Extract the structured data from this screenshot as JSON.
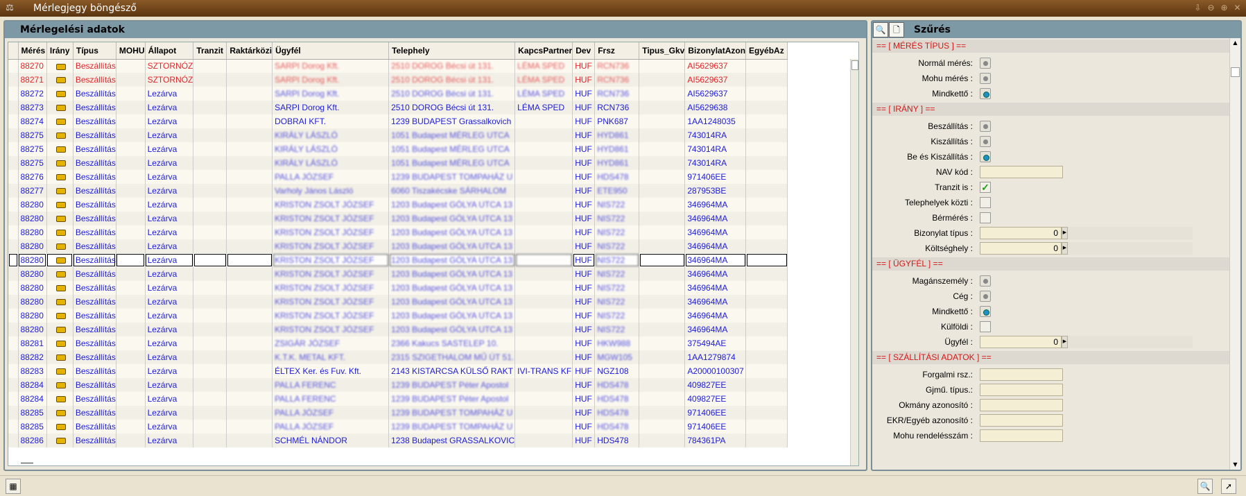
{
  "window": {
    "title": "Mérlegjegy böngésző"
  },
  "left": {
    "title": "Mérlegelési adatok",
    "columns": [
      "",
      "Mérés",
      "Irány",
      "Típus",
      "MOHU",
      "Állapot",
      "Tranzit",
      "Raktárközi",
      "Ügyfél",
      "Telephely",
      "KapcsPartner",
      "Dev",
      "Frsz",
      "Tipus_Gkv",
      "BizonylatAzon",
      "EgyébAz"
    ]
  },
  "rows": [
    {
      "id": "88270",
      "tipus": "Beszállítás",
      "allapot": "SZTORNÓZ",
      "ugyfel": "SARPI Dorog Kft.",
      "telephely": "2510 DOROG Bécsi út 131.",
      "kapcs": "LÉMA SPED",
      "dev": "HUF",
      "frsz": "RCN736",
      "biz": "AI5629637",
      "color": "red"
    },
    {
      "id": "88271",
      "tipus": "Beszállítás",
      "allapot": "SZTORNÓZ",
      "ugyfel": "SARPI Dorog Kft.",
      "telephely": "2510 DOROG Bécsi út 131.",
      "kapcs": "LÉMA SPED",
      "dev": "HUF",
      "frsz": "RCN736",
      "biz": "AI5629637",
      "color": "red"
    },
    {
      "id": "88272",
      "tipus": "Beszállítás",
      "allapot": "Lezárva",
      "ugyfel": "SARPI Dorog Kft.",
      "telephely": "2510 DOROG Bécsi út 131.",
      "kapcs": "LÉMA SPED",
      "dev": "HUF",
      "frsz": "RCN736",
      "biz": "AI5629637",
      "color": "blue"
    },
    {
      "id": "88273",
      "tipus": "Beszállítás",
      "allapot": "Lezárva",
      "ugyfel": "SARPI Dorog Kft.",
      "telephely": "2510 DOROG Bécsi út 131.",
      "kapcs": "LÉMA SPED",
      "dev": "HUF",
      "frsz": "RCN736",
      "biz": "AI5629638",
      "color": "blue"
    },
    {
      "id": "88274",
      "tipus": "Beszállítás",
      "allapot": "Lezárva",
      "ugyfel": "DOBRAI KFT.",
      "telephely": "1239 BUDAPEST Grassalkovich",
      "kapcs": "",
      "dev": "HUF",
      "frsz": "PNK687",
      "biz": "1AA1248035",
      "color": "blue"
    },
    {
      "id": "88275",
      "tipus": "Beszállítás",
      "allapot": "Lezárva",
      "ugyfel": "KIRÁLY LÁSZLÓ",
      "telephely": "1051 Budapest MÉRLEG UTCA",
      "kapcs": "",
      "dev": "HUF",
      "frsz": "HYD861",
      "biz": "743014RA",
      "color": "blue"
    },
    {
      "id": "88275",
      "tipus": "Beszállítás",
      "allapot": "Lezárva",
      "ugyfel": "KIRÁLY LÁSZLÓ",
      "telephely": "1051 Budapest MÉRLEG UTCA",
      "kapcs": "",
      "dev": "HUF",
      "frsz": "HYD861",
      "biz": "743014RA",
      "color": "blue"
    },
    {
      "id": "88275",
      "tipus": "Beszállítás",
      "allapot": "Lezárva",
      "ugyfel": "KIRÁLY LÁSZLÓ",
      "telephely": "1051 Budapest MÉRLEG UTCA",
      "kapcs": "",
      "dev": "HUF",
      "frsz": "HYD861",
      "biz": "743014RA",
      "color": "blue"
    },
    {
      "id": "88276",
      "tipus": "Beszállítás",
      "allapot": "Lezárva",
      "ugyfel": "PALLA JÓZSEF",
      "telephely": "1239 BUDAPEST TOMPAHÁZ U",
      "kapcs": "",
      "dev": "HUF",
      "frsz": "HDS478",
      "biz": "971406EE",
      "color": "blue"
    },
    {
      "id": "88277",
      "tipus": "Beszállítás",
      "allapot": "Lezárva",
      "ugyfel": "Varholy János László",
      "telephely": "6060 Tiszakécske SÁRHALOM",
      "kapcs": "",
      "dev": "HUF",
      "frsz": "ETE950",
      "biz": "287953BE",
      "color": "blue"
    },
    {
      "id": "88280",
      "tipus": "Beszállítás",
      "allapot": "Lezárva",
      "ugyfel": "KRISTON ZSOLT JÓZSEF",
      "telephely": "1203 Budapest GÓLYA UTCA 13",
      "kapcs": "",
      "dev": "HUF",
      "frsz": "NIS722",
      "biz": "346964MA",
      "color": "blue"
    },
    {
      "id": "88280",
      "tipus": "Beszállítás",
      "allapot": "Lezárva",
      "ugyfel": "KRISTON ZSOLT JÓZSEF",
      "telephely": "1203 Budapest GÓLYA UTCA 13",
      "kapcs": "",
      "dev": "HUF",
      "frsz": "NIS722",
      "biz": "346964MA",
      "color": "blue"
    },
    {
      "id": "88280",
      "tipus": "Beszállítás",
      "allapot": "Lezárva",
      "ugyfel": "KRISTON ZSOLT JÓZSEF",
      "telephely": "1203 Budapest GÓLYA UTCA 13",
      "kapcs": "",
      "dev": "HUF",
      "frsz": "NIS722",
      "biz": "346964MA",
      "color": "blue"
    },
    {
      "id": "88280",
      "tipus": "Beszállítás",
      "allapot": "Lezárva",
      "ugyfel": "KRISTON ZSOLT JÓZSEF",
      "telephely": "1203 Budapest GÓLYA UTCA 13",
      "kapcs": "",
      "dev": "HUF",
      "frsz": "NIS722",
      "biz": "346964MA",
      "color": "blue"
    },
    {
      "id": "88280",
      "tipus": "Beszállítás",
      "allapot": "Lezárva",
      "ugyfel": "KRISTON ZSOLT JÓZSEF",
      "telephely": "1203 Budapest GÓLYA UTCA 13",
      "kapcs": "",
      "dev": "HUF",
      "frsz": "NIS722",
      "biz": "346964MA",
      "color": "blue",
      "selected": true
    },
    {
      "id": "88280",
      "tipus": "Beszállítás",
      "allapot": "Lezárva",
      "ugyfel": "KRISTON ZSOLT JÓZSEF",
      "telephely": "1203 Budapest GÓLYA UTCA 13",
      "kapcs": "",
      "dev": "HUF",
      "frsz": "NIS722",
      "biz": "346964MA",
      "color": "blue"
    },
    {
      "id": "88280",
      "tipus": "Beszállítás",
      "allapot": "Lezárva",
      "ugyfel": "KRISTON ZSOLT JÓZSEF",
      "telephely": "1203 Budapest GÓLYA UTCA 13",
      "kapcs": "",
      "dev": "HUF",
      "frsz": "NIS722",
      "biz": "346964MA",
      "color": "blue"
    },
    {
      "id": "88280",
      "tipus": "Beszállítás",
      "allapot": "Lezárva",
      "ugyfel": "KRISTON ZSOLT JÓZSEF",
      "telephely": "1203 Budapest GÓLYA UTCA 13",
      "kapcs": "",
      "dev": "HUF",
      "frsz": "NIS722",
      "biz": "346964MA",
      "color": "blue"
    },
    {
      "id": "88280",
      "tipus": "Beszállítás",
      "allapot": "Lezárva",
      "ugyfel": "KRISTON ZSOLT JÓZSEF",
      "telephely": "1203 Budapest GÓLYA UTCA 13",
      "kapcs": "",
      "dev": "HUF",
      "frsz": "NIS722",
      "biz": "346964MA",
      "color": "blue"
    },
    {
      "id": "88280",
      "tipus": "Beszállítás",
      "allapot": "Lezárva",
      "ugyfel": "KRISTON ZSOLT JÓZSEF",
      "telephely": "1203 Budapest GÓLYA UTCA 13",
      "kapcs": "",
      "dev": "HUF",
      "frsz": "NIS722",
      "biz": "346964MA",
      "color": "blue"
    },
    {
      "id": "88281",
      "tipus": "Beszállítás",
      "allapot": "Lezárva",
      "ugyfel": "ZSIGÁR JÓZSEF",
      "telephely": "2366 Kakucs SASTELEP 10.",
      "kapcs": "",
      "dev": "HUF",
      "frsz": "HKW988",
      "biz": "375494AE",
      "color": "blue"
    },
    {
      "id": "88282",
      "tipus": "Beszállítás",
      "allapot": "Lezárva",
      "ugyfel": "K.T.K. METAL KFT.",
      "telephely": "2315 SZIGETHALOM MŰ ÚT 51.",
      "kapcs": "",
      "dev": "HUF",
      "frsz": "MGW105",
      "biz": "1AA1279874",
      "color": "blue"
    },
    {
      "id": "88283",
      "tipus": "Beszállítás",
      "allapot": "Lezárva",
      "ugyfel": "ÉLTEX Ker. és Fuv. Kft.",
      "telephely": "2143 KISTARCSA KÜLSŐ RAKT",
      "kapcs": "IVI-TRANS KF",
      "dev": "HUF",
      "frsz": "NGZ108",
      "biz": "A20000100307",
      "color": "blue"
    },
    {
      "id": "88284",
      "tipus": "Beszállítás",
      "allapot": "Lezárva",
      "ugyfel": "PALLA FERENC",
      "telephely": "1239 BUDAPEST Péter Apostol",
      "kapcs": "",
      "dev": "HUF",
      "frsz": "HDS478",
      "biz": "409827EE",
      "color": "blue"
    },
    {
      "id": "88284",
      "tipus": "Beszállítás",
      "allapot": "Lezárva",
      "ugyfel": "PALLA FERENC",
      "telephely": "1239 BUDAPEST Péter Apostol",
      "kapcs": "",
      "dev": "HUF",
      "frsz": "HDS478",
      "biz": "409827EE",
      "color": "blue"
    },
    {
      "id": "88285",
      "tipus": "Beszállítás",
      "allapot": "Lezárva",
      "ugyfel": "PALLA JÓZSEF",
      "telephely": "1239 BUDAPEST TOMPAHÁZ U",
      "kapcs": "",
      "dev": "HUF",
      "frsz": "HDS478",
      "biz": "971406EE",
      "color": "blue"
    },
    {
      "id": "88285",
      "tipus": "Beszállítás",
      "allapot": "Lezárva",
      "ugyfel": "PALLA JÓZSEF",
      "telephely": "1239 BUDAPEST TOMPAHÁZ U",
      "kapcs": "",
      "dev": "HUF",
      "frsz": "HDS478",
      "biz": "971406EE",
      "color": "blue"
    },
    {
      "id": "88286",
      "tipus": "Beszállítás",
      "allapot": "Lezárva",
      "ugyfel": "SCHMÉL NÁNDOR",
      "telephely": "1238 Budapest GRASSALKOVIC",
      "kapcs": "",
      "dev": "HUF",
      "frsz": "HDS478",
      "biz": "784361PA",
      "color": "blue"
    }
  ],
  "filter": {
    "title": "Szűrés",
    "sections": [
      {
        "title": "== [ MÉRÉS TÍPUS ] ==",
        "rows": [
          {
            "label": "Normál mérés:",
            "kind": "radio",
            "on": false
          },
          {
            "label": "Mohu mérés :",
            "kind": "radio",
            "on": false
          },
          {
            "label": "Mindkettő :",
            "kind": "radio",
            "on": true
          }
        ]
      },
      {
        "title": "== [ IRÁNY ] ==",
        "rows": [
          {
            "label": "Beszállítás :",
            "kind": "radio",
            "on": false
          },
          {
            "label": "Kiszállítás :",
            "kind": "radio",
            "on": false
          },
          {
            "label": "Be és Kiszállítás :",
            "kind": "radio",
            "on": true
          },
          {
            "label": "NAV kód :",
            "kind": "text",
            "value": ""
          },
          {
            "label": "Tranzit is :",
            "kind": "check",
            "on": true
          },
          {
            "label": "Telephelyek közti :",
            "kind": "check",
            "on": false
          },
          {
            "label": "Bérmérés :",
            "kind": "check",
            "on": false
          },
          {
            "label": "Bizonylat típus :",
            "kind": "num",
            "value": "0"
          },
          {
            "label": "Költséghely :",
            "kind": "num",
            "value": "0"
          }
        ]
      },
      {
        "title": "== [ ÜGYFÉL ] ==",
        "rows": [
          {
            "label": "Magánszemély :",
            "kind": "radio",
            "on": false
          },
          {
            "label": "Cég :",
            "kind": "radio",
            "on": false
          },
          {
            "label": "Mindkettő :",
            "kind": "radio",
            "on": true
          },
          {
            "label": "Külföldi :",
            "kind": "check",
            "on": false
          },
          {
            "label": "Ügyfél :",
            "kind": "num",
            "value": "0"
          }
        ]
      },
      {
        "title": "== [ SZÁLLÍTÁSI ADATOK ] ==",
        "rows": [
          {
            "label": "Forgalmi rsz.:",
            "kind": "text",
            "value": ""
          },
          {
            "label": "Gjmű. típus.:",
            "kind": "text",
            "value": ""
          },
          {
            "label": "Okmány azonosító :",
            "kind": "text",
            "value": ""
          },
          {
            "label": "EKR/Egyéb azonosító :",
            "kind": "text",
            "value": ""
          },
          {
            "label": "Mohu rendelésszám :",
            "kind": "text",
            "value": ""
          }
        ]
      }
    ]
  }
}
